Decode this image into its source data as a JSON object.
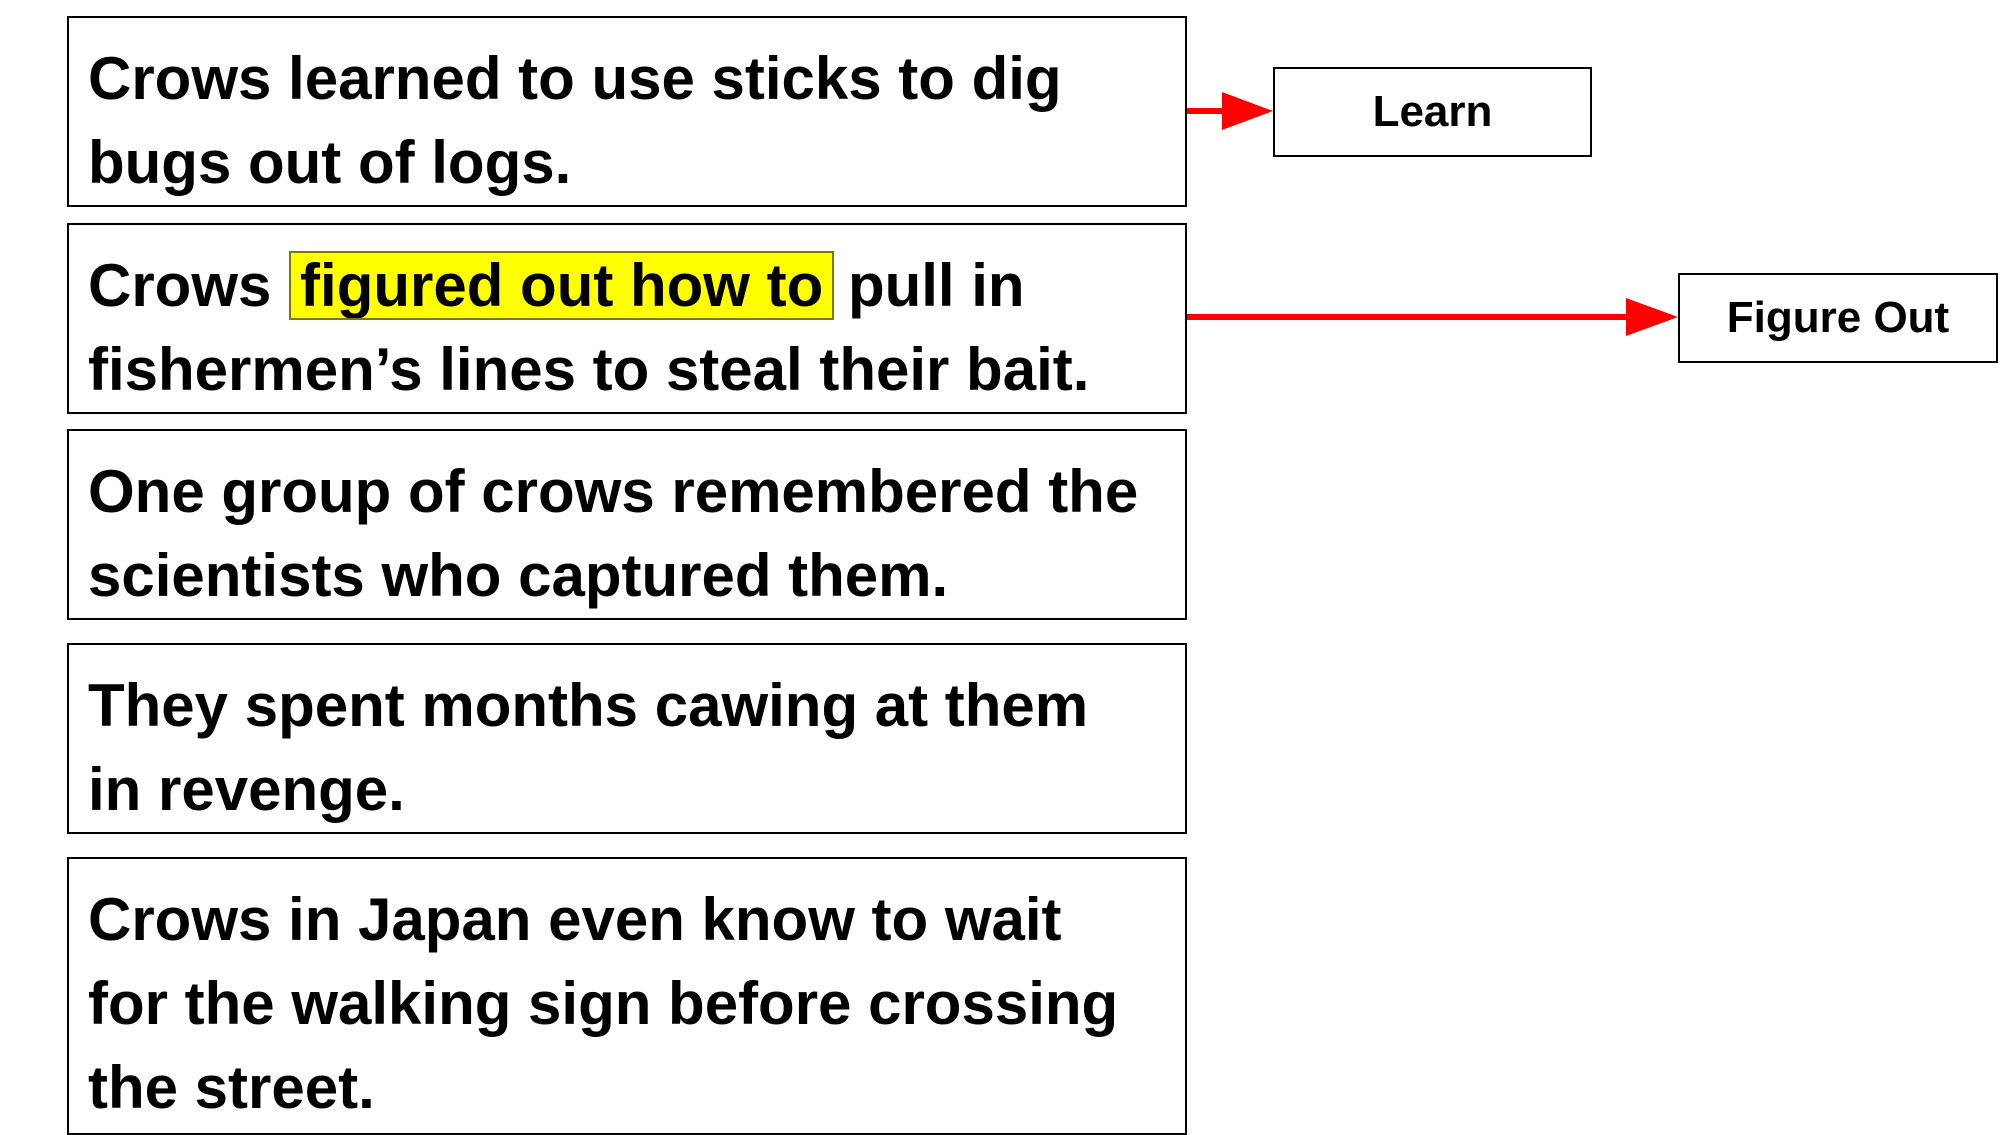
{
  "sentences": [
    {
      "lines": [
        "Crows learned to use sticks to dig",
        "bugs out of logs."
      ]
    },
    {
      "before": "Crows",
      "highlight": "figured out how to",
      "after": "pull in",
      "line2": "fishermen’s lines to steal their bait."
    },
    {
      "lines": [
        "One group of crows remembered the",
        "scientists who captured them."
      ]
    },
    {
      "lines": [
        "They spent months cawing at them",
        "in revenge."
      ]
    },
    {
      "lines": [
        "Crows in Japan even know to wait",
        "for the walking sign before crossing",
        "the street."
      ]
    }
  ],
  "labels": {
    "learn": "Learn",
    "figure_out": "Figure Out"
  },
  "colors": {
    "arrow": "#ff0000",
    "highlight": "#ffff00",
    "border": "#000000"
  }
}
